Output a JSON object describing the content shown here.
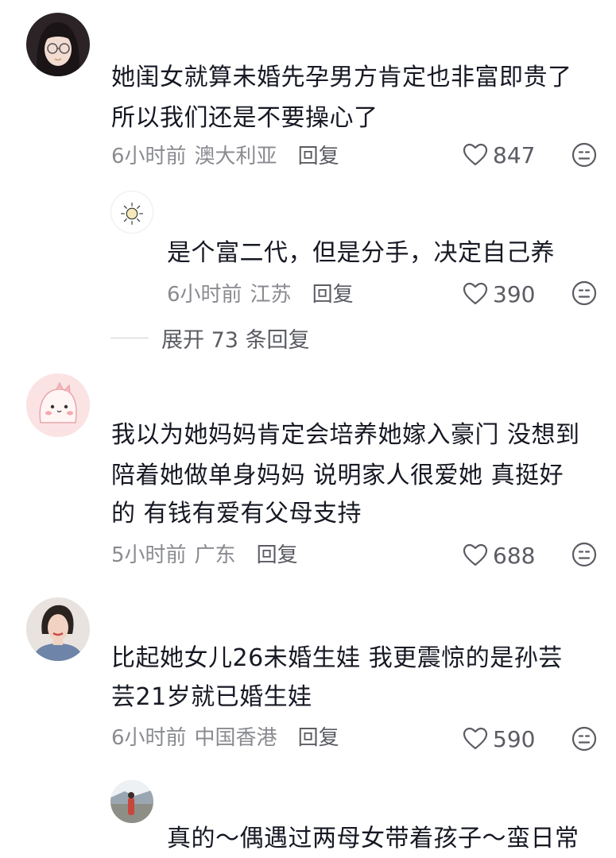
{
  "comments": [
    {
      "avatar_icon": "anime-girl-glasses-avatar",
      "lines": [
        "她闺女就算未婚先孕男方肯定也非富即贵了",
        "所以我们还是不要操心了"
      ],
      "time": "6小时前",
      "location": "澳大利亚",
      "reply_label": "回复",
      "likes": "847"
    },
    {
      "avatar_icon": "sun-sketch-avatar",
      "lines": [
        "是个富二代，但是分手，决定自己养"
      ],
      "time": "6小时前",
      "location": "江苏",
      "reply_label": "回复",
      "likes": "390"
    },
    {
      "avatar_icon": "pink-dino-avatar",
      "lines": [
        "我以为她妈妈肯定会培养她嫁入豪门 没想到",
        "陪着她做单身妈妈 说明家人很爱她 真挺好",
        "的 有钱有爱有父母支持"
      ],
      "time": "5小时前",
      "location": "广东",
      "reply_label": "回复",
      "likes": "688"
    },
    {
      "avatar_icon": "woman-portrait-avatar",
      "lines": [
        "比起她女儿26未婚生娃 我更震惊的是孙芸",
        "芸21岁就已婚生娃"
      ],
      "time": "6小时前",
      "location": "中国香港",
      "reply_label": "回复",
      "likes": "590"
    },
    {
      "avatar_icon": "outdoor-photo-avatar",
      "lines": [
        "真的～偶遇过两母女带着孩子～蛮日常"
      ]
    }
  ],
  "expand_replies_label": "展开 73 条回复",
  "icons": {
    "like": "heart-outline-icon",
    "dislike": "meh-face-icon"
  },
  "colors": {
    "text": "#161823",
    "meta": "#8a8b91",
    "action": "#5b5c63"
  }
}
